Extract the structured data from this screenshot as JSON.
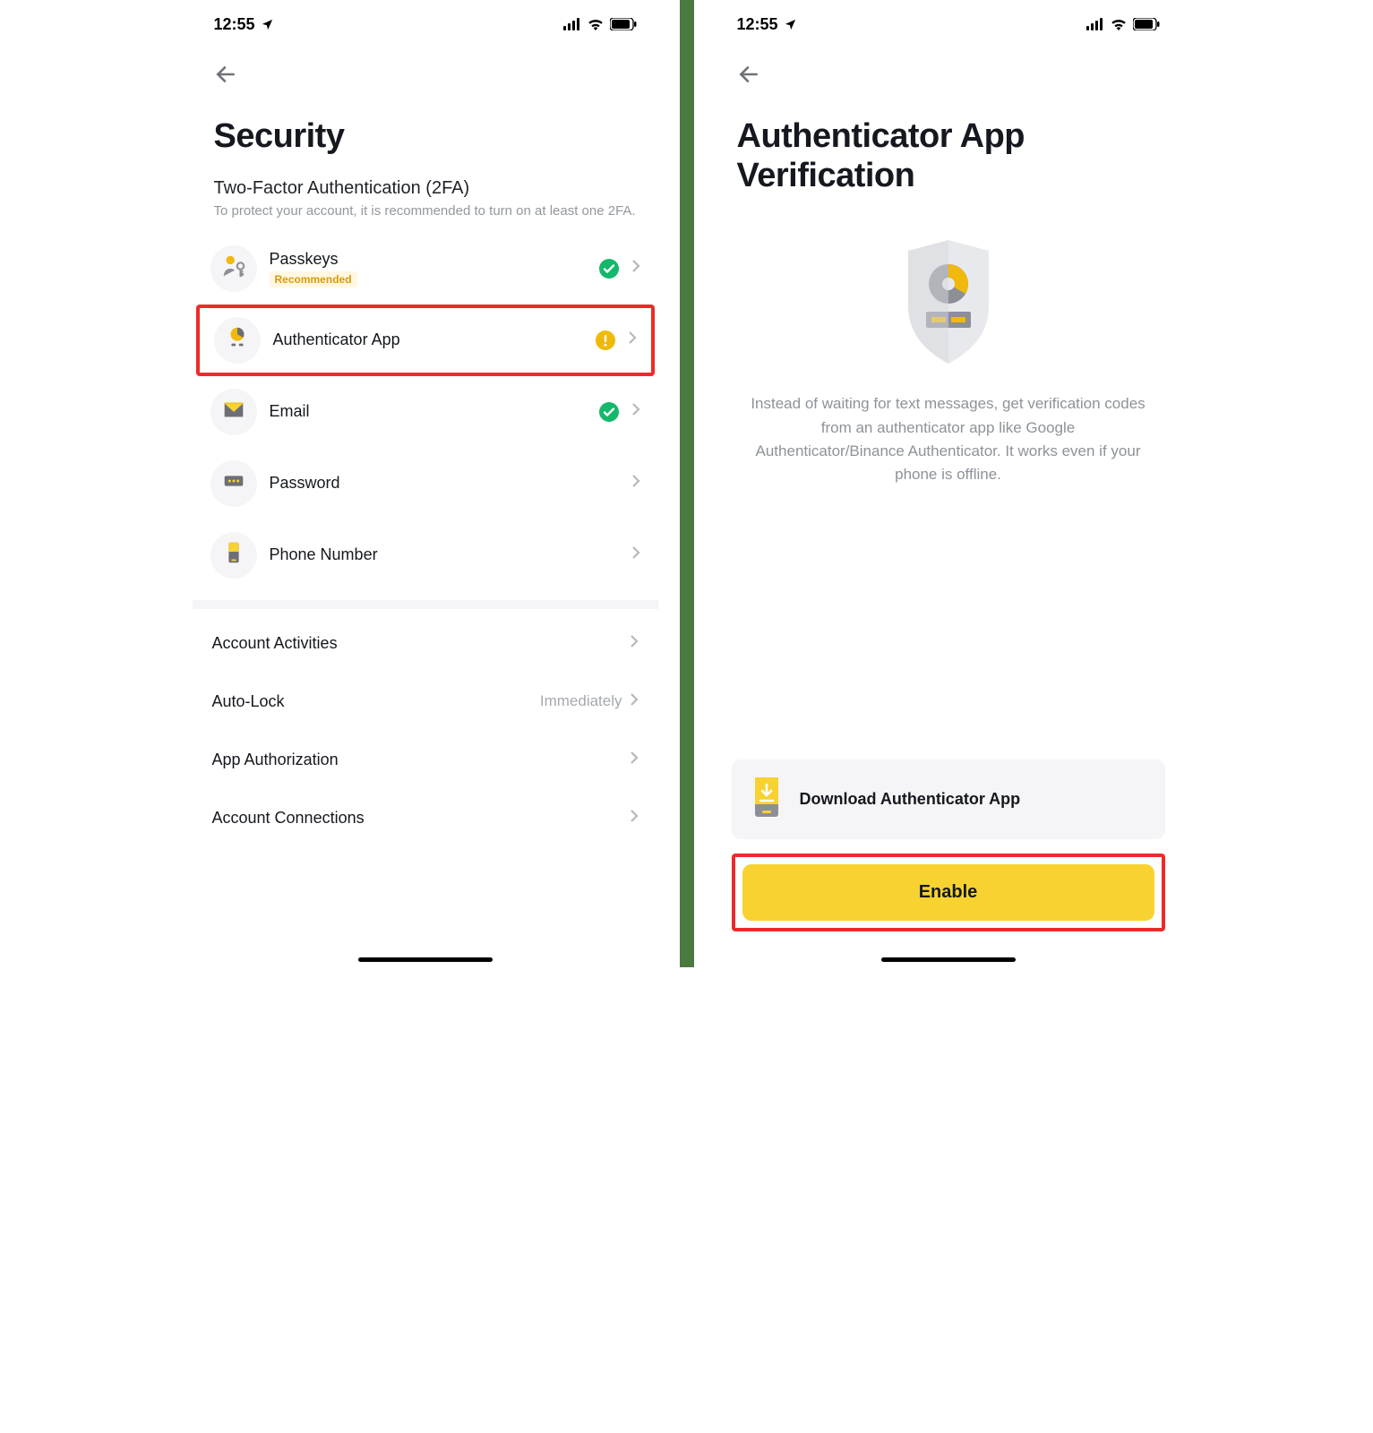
{
  "statusbar": {
    "time": "12:55"
  },
  "left": {
    "title": "Security",
    "section": {
      "title": "Two-Factor Authentication (2FA)",
      "subtitle": "To protect your account, it is recommended to turn on at least one 2FA."
    },
    "items": [
      {
        "label": "Passkeys",
        "badge": "Recommended",
        "status": "check"
      },
      {
        "label": "Authenticator App",
        "status": "warning",
        "highlight": true
      },
      {
        "label": "Email",
        "status": "check"
      },
      {
        "label": "Password"
      },
      {
        "label": "Phone Number"
      }
    ],
    "more": [
      {
        "label": "Account Activities"
      },
      {
        "label": "Auto-Lock",
        "value": "Immediately"
      },
      {
        "label": "App Authorization"
      },
      {
        "label": "Account Connections"
      }
    ]
  },
  "right": {
    "title": "Authenticator App Verification",
    "description": "Instead of waiting for text messages, get verification codes from an authenticator app like Google Authenticator/Binance Authenticator. It works even if your phone is offline.",
    "download_label": "Download Authenticator App",
    "enable_label": "Enable"
  }
}
